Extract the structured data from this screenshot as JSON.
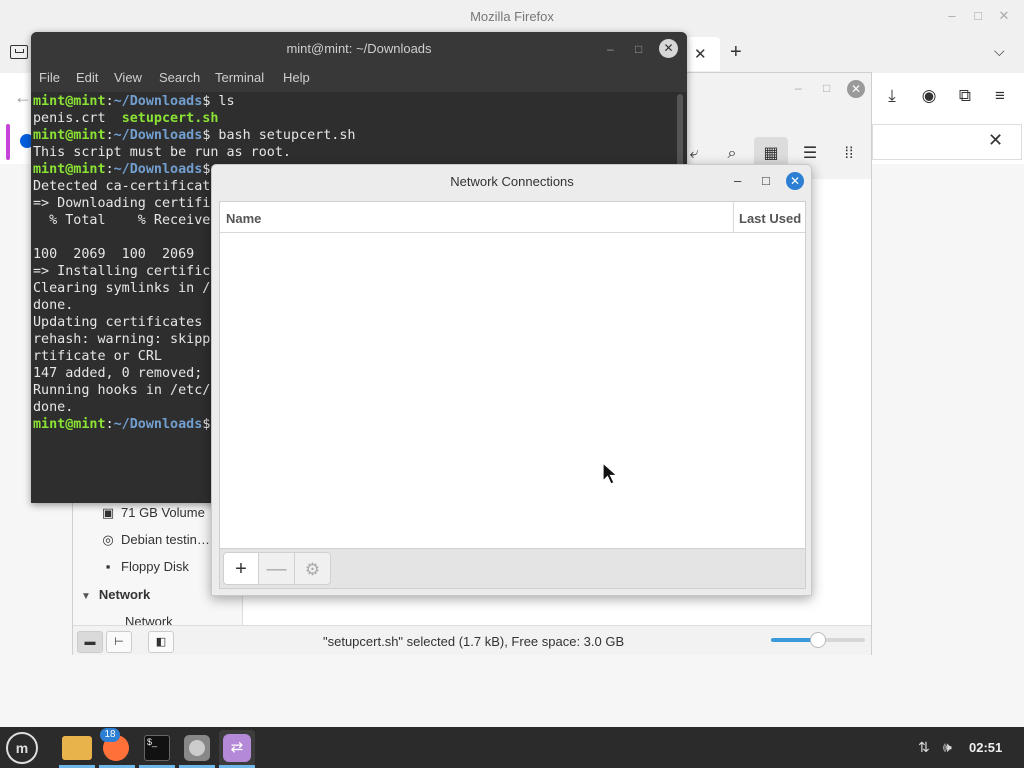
{
  "firefox": {
    "title": "Mozilla Firefox",
    "tab_close": "✕",
    "new_tab": "+",
    "tab_list": "⌵",
    "nav_icons": [
      "download-icon",
      "account-icon",
      "extensions-icon",
      "menu-icon"
    ],
    "notification_close": "✕"
  },
  "file_manager": {
    "sidebar": {
      "devices": [
        {
          "label": "71 GB Volume",
          "icon": "drive-icon"
        },
        {
          "label": "Debian testin…",
          "icon": "disc-icon"
        },
        {
          "label": "Floppy Disk",
          "icon": "floppy-icon"
        }
      ],
      "network_heading": "Network",
      "network_items": [
        {
          "label": "Network",
          "icon": "network-icon"
        }
      ]
    },
    "status_text": "\"setupcert.sh\" selected (1.7 kB), Free space: 3.0 GB",
    "zoom_level": 0.5
  },
  "terminal": {
    "title": "mint@mint: ~/Downloads",
    "menu": [
      "File",
      "Edit",
      "View",
      "Search",
      "Terminal",
      "Help"
    ],
    "prompt_user": "mint@mint",
    "prompt_path": "~/Downloads",
    "lines": [
      {
        "type": "prompt",
        "cmd": " ls"
      },
      {
        "type": "files",
        "plain": "penis.crt  ",
        "exec": "setupcert.sh"
      },
      {
        "type": "prompt",
        "cmd": " bash setupcert.sh"
      },
      {
        "type": "text",
        "text": "This script must be run as root."
      },
      {
        "type": "prompt",
        "cmd": ""
      },
      {
        "type": "text",
        "text": "Detected ca-certificate"
      },
      {
        "type": "text",
        "text": "=> Downloading certific"
      },
      {
        "type": "text",
        "text": "  % Total    % Received"
      },
      {
        "type": "text",
        "text": ""
      },
      {
        "type": "text",
        "text": "100  2069  100  2069"
      },
      {
        "type": "text",
        "text": "=> Installing certifica"
      },
      {
        "type": "text",
        "text": "Clearing symlinks in /e"
      },
      {
        "type": "text",
        "text": "done."
      },
      {
        "type": "text",
        "text": "Updating certificates i"
      },
      {
        "type": "text",
        "text": "rehash: warning: skippi"
      },
      {
        "type": "text",
        "text": "rtificate or CRL"
      },
      {
        "type": "text",
        "text": "147 added, 0 removed; d"
      },
      {
        "type": "text",
        "text": "Running hooks in /etc/c"
      },
      {
        "type": "text",
        "text": "done."
      },
      {
        "type": "prompt",
        "cmd": ""
      }
    ]
  },
  "network_dialog": {
    "title": "Network Connections",
    "columns": {
      "name": "Name",
      "last_used": "Last Used"
    },
    "toolbar": {
      "add": "+",
      "remove": "—",
      "settings": "⚙"
    }
  },
  "taskbar": {
    "menu_label": "m",
    "firefox_badge": "18",
    "terminal_label": "$_",
    "clock": "02:51"
  }
}
